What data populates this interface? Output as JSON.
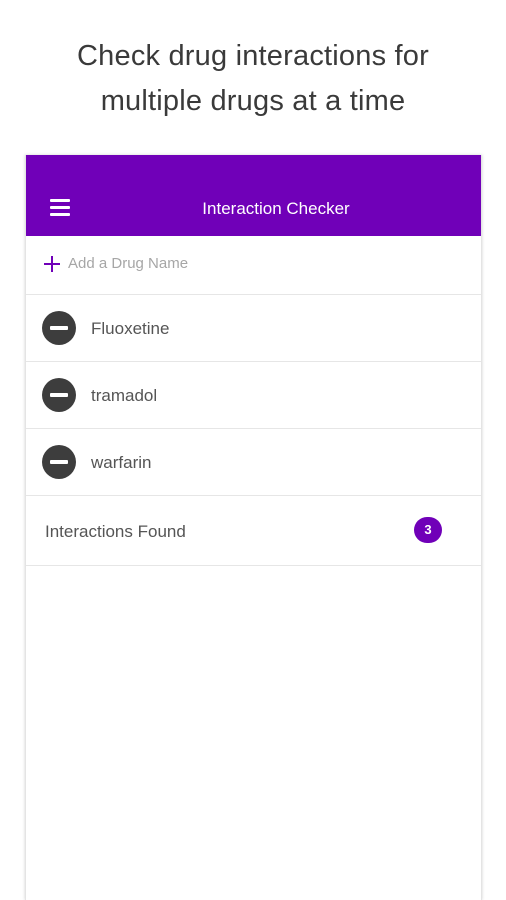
{
  "promo": {
    "line1": "Check drug interactions for",
    "line2": "multiple drugs at a time"
  },
  "app_bar": {
    "title": "Interaction Checker",
    "menu_icon": "hamburger-menu-icon"
  },
  "add_drug": {
    "placeholder": "Add a Drug Name",
    "icon": "plus-icon"
  },
  "drugs": [
    {
      "name": "Fluoxetine",
      "icon": "remove-circle-icon"
    },
    {
      "name": "tramadol",
      "icon": "remove-circle-icon"
    },
    {
      "name": "warfarin",
      "icon": "remove-circle-icon"
    }
  ],
  "interactions": {
    "label": "Interactions Found",
    "count": "3"
  },
  "colors": {
    "accent": "#7000b8",
    "remove_icon": "#3d3d3d",
    "text": "#555555",
    "placeholder": "#a6a6a6"
  }
}
